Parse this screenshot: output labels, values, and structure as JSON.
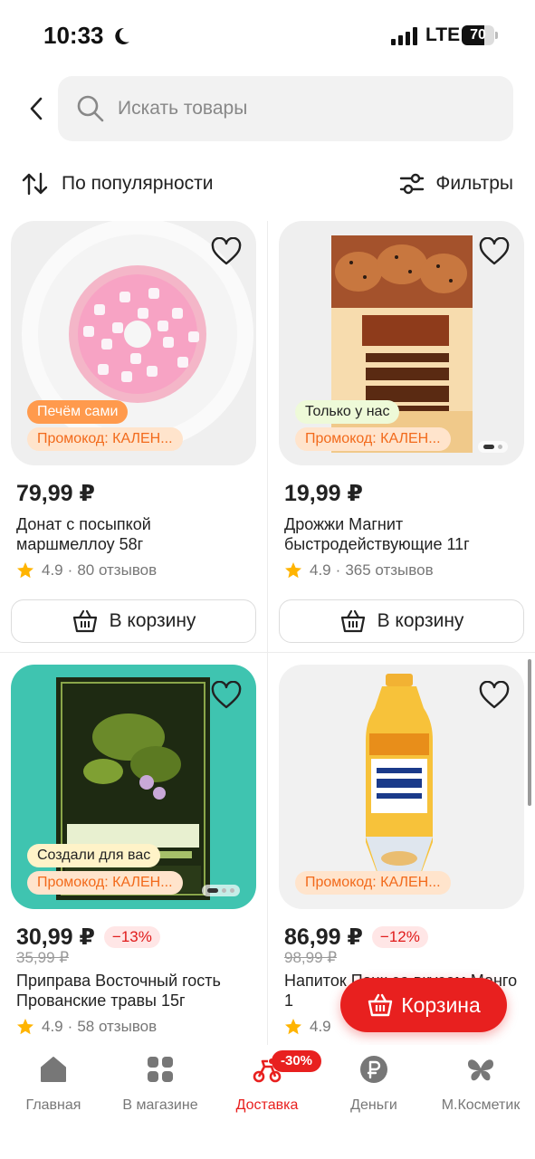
{
  "status_bar": {
    "time": "10:33",
    "network": "LTE",
    "battery": "70",
    "battery_level": 0.7
  },
  "search": {
    "placeholder": "Искать товары"
  },
  "sort": {
    "label": "По популярности"
  },
  "filters": {
    "label": "Фильтры"
  },
  "products": [
    {
      "price": "79,99 ₽",
      "name": "Донат с посыпкой маршмеллоу 58г",
      "rating": "4.9",
      "reviews": "80 отзывов",
      "badges": [
        "Печём сами",
        "Промокод: КАЛЕН..."
      ],
      "add_to_cart": "В корзину"
    },
    {
      "price": "19,99 ₽",
      "name": "Дрожжи Магнит быстродействующие 11г",
      "rating": "4.9",
      "reviews": "365 отзывов",
      "badges": [
        "Только у нас",
        "Промокод: КАЛЕН..."
      ],
      "add_to_cart": "В корзину"
    },
    {
      "price": "30,99 ₽",
      "discount": "−13%",
      "old_price": "35,99 ₽",
      "name": "Приправа Восточный гость Прованские травы 15г",
      "rating": "4.9",
      "reviews": "58 отзывов",
      "badges": [
        "Создали для вас",
        "Промокод: КАЛЕН..."
      ]
    },
    {
      "price": "86,99 ₽",
      "discount": "−12%",
      "old_price": "98,99 ₽",
      "name": "Напиток Пачк со вкусом Манго 1",
      "rating": "4.9",
      "badges": [
        "Промокод: КАЛЕН..."
      ]
    }
  ],
  "float_cart": {
    "label": "Корзина"
  },
  "bottom_nav": [
    {
      "label": "Главная",
      "icon": "home-icon"
    },
    {
      "label": "В магазине",
      "icon": "grid-icon"
    },
    {
      "label": "Доставка",
      "icon": "delivery-icon",
      "badge": "-30%",
      "active": true
    },
    {
      "label": "Деньги",
      "icon": "ruble-icon"
    },
    {
      "label": "М.Косметик",
      "icon": "butterfly-icon"
    }
  ],
  "colors": {
    "accent": "#e8201f",
    "promo": "#f26a1b",
    "orange_badge": "#ff9a4d",
    "teal_bg": "#3fc4b0"
  }
}
